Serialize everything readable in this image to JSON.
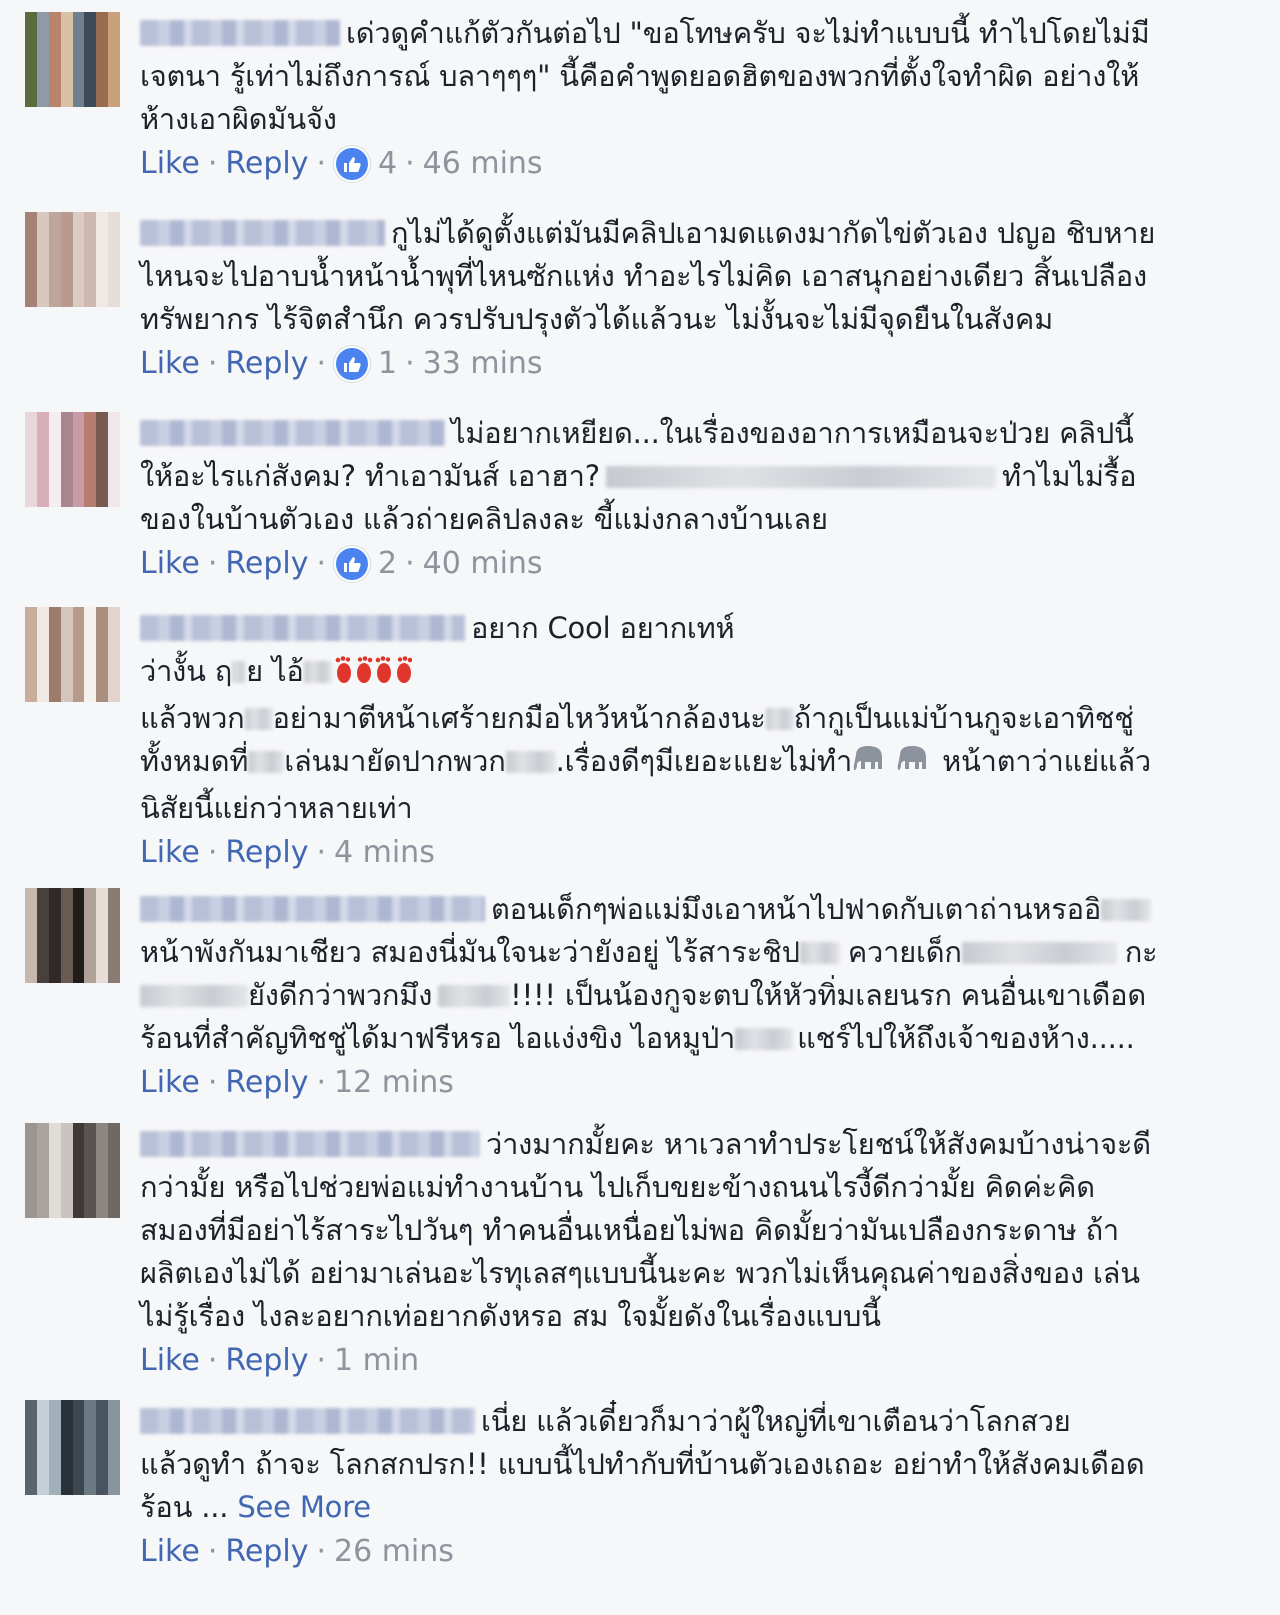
{
  "actions": {
    "like": "Like",
    "reply": "Reply",
    "see_more": "See More"
  },
  "colors": {
    "link": "#4267b2",
    "meta": "#8d949e",
    "reaction": "#4a83f0",
    "background": "#f6f7f9"
  },
  "icons": {
    "reaction": "thumbs-up-icon",
    "footprints": "footprints-icon",
    "elephant": "elephant-icon"
  },
  "comments": [
    {
      "lines": [
        "เด่วดูคำแก้ตัวกันต่อไป \"ขอโทษครับ จะไม่ทำแบบนี้ ทำไปโดยไม่มี",
        "เจตนา รู้เท่าไม่ถึงการณ์ บลาๆๆๆ\" นี้คือคำพูดยอดฮิตของพวกที่ตั้งใจทำผิด อย่างให้",
        "ห้างเอาผิดมันจัง"
      ],
      "reactions": "4",
      "time": "46 mins"
    },
    {
      "lines": [
        "กูไม่ได้ดูตั้งแต่มันมีคลิปเอามดแดงมากัดไข่ตัวเอง ปญอ ชิบหาย",
        "ไหนจะไปอาบน้ำหน้าน้ำพุที่ไหนซักแห่ง ทำอะไรไม่คิด เอาสนุกอย่างเดียว สิ้นเปลือง",
        "ทรัพยากร ไร้จิตสำนึก ควรปรับปรุงตัวได้แล้วนะ ไม่งั้นจะไม่มีจุดยืนในสังคม"
      ],
      "reactions": "1",
      "time": "33 mins"
    },
    {
      "lines": [
        "ไม่อยากเหยียด...ในเรื่องของอาการเหมือนจะป่วย คลิปนี้",
        "ให้อะไรแก่สังคม? ทำเอามันส์ เอาฮา?",
        "ทำไมไม่รื้อ",
        "ของในบ้านตัวเอง แล้วถ่ายคลิปลงละ ขี้แม่งกลางบ้านเลย"
      ],
      "reactions": "2",
      "time": "40 mins"
    },
    {
      "lines": [
        "อยาก Cool อยากเทห์",
        "ว่างั้น ฤ",
        "ย ไอ้",
        "แล้วพวก",
        "อย่ามาตีหน้าเศร้ายกมือไหว้หน้ากล้องนะ",
        "ถ้ากูเป็นแม่บ้านกูจะเอาทิชชู่",
        "ทั้งหมดที่",
        "เล่นมายัดปากพวก",
        ".เรื่องดีๆมีเยอะแยะไม่ทำ",
        "หน้าตาว่าแย่แล้ว",
        "นิสัยนี้แย่กว่าหลายเท่า"
      ],
      "time": "4 mins"
    },
    {
      "lines": [
        "ตอนเด็กๆพ่อแม่มึงเอาหน้าไปฟาดกับเตาถ่านหรออิ",
        "หน้าพังกันมาเชียว สมองนี่มันใจนะว่ายังอยู่ ไร้สาระชิป",
        "ควายเด็ก",
        "กะ",
        "ยังดีกว่าพวกมึง",
        "!!!! เป็นน้องกูจะตบให้หัวทิ่มเลยนรก คนอื่นเขาเดือด",
        "ร้อนที่สำคัญทิชชู่ได้มาฟรีหรอ ไอแง่งขิง ไอหมูป่า",
        "แชร์ไปให้ถึงเจ้าของห้าง....."
      ],
      "time": "12 mins"
    },
    {
      "lines": [
        "ว่างมากมั้ยคะ หาเวลาทำประโยชน์ให้สังคมบ้างน่าจะดี",
        "กว่ามั้ย หรือไปช่วยพ่อแม่ทำงานบ้าน ไปเก็บขยะข้างถนนไรงี้ดีกว่ามั้ย คิดค่ะคิด",
        "สมองที่มีอย่าไร้สาระไปวันๆ ทำคนอื่นเหนื่อยไม่พอ คิดมั้ยว่ามันเปลืองกระดาษ ถ้า",
        "ผลิตเองไม่ได้ อย่ามาเล่นอะไรทุเลสๆแบบนี้นะคะ พวกไม่เห็นคุณค่าของสิ่งของ เล่น",
        "ไม่รู้เรื่อง ไงละอยากเท่อยากดังหรอ สม ใจมั้ยดังในเรื่องแบบนี้"
      ],
      "time": "1 min"
    },
    {
      "lines": [
        "เนี่ย แล้วเดี๋ยวก็มาว่าผู้ใหญ่ที่เขาเตือนว่าโลกสวย",
        "แล้วดูทำ ถ้าจะ โลกสกปรก!! แบบนี้ไปทำกับที่บ้านตัวเองเถอะ อย่าทำให้สังคมเดือด",
        "ร้อน ..."
      ],
      "time": "26 mins"
    }
  ]
}
